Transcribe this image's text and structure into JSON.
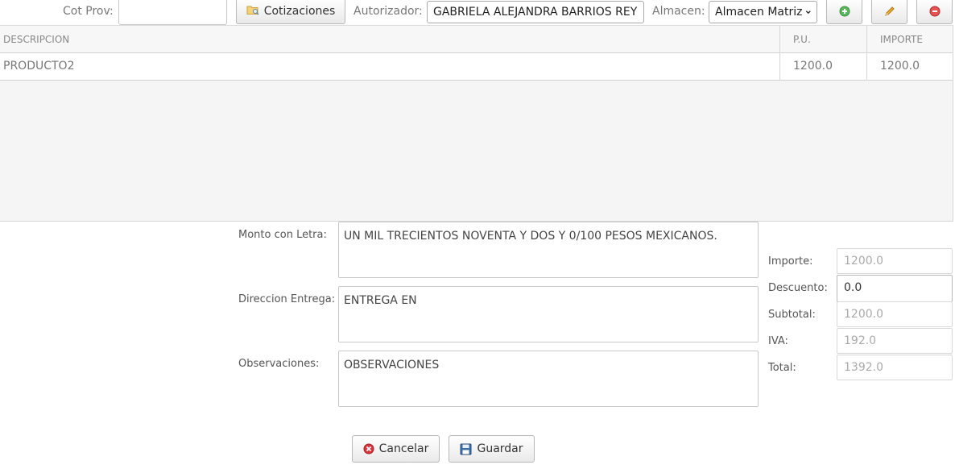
{
  "toolbar": {
    "cot_prov_label": "Cot Prov:",
    "cot_prov_value": "",
    "cotizaciones_label": "Cotizaciones",
    "autorizador_label": "Autorizador:",
    "autorizador_value": "GABRIELA ALEJANDRA BARRIOS REY",
    "almacen_label": "Almacen:",
    "almacen_value": "Almacen Matriz",
    "add_icon": "add-icon",
    "edit_icon": "pencil-icon",
    "remove_icon": "remove-icon"
  },
  "grid": {
    "columns": [
      "DESCRIPCION",
      "P.U.",
      "IMPORTE"
    ],
    "rows": [
      {
        "descripcion": "PRODUCTO2",
        "pu": "1200.0",
        "importe": "1200.0"
      }
    ]
  },
  "form": {
    "monto_label": "Monto con Letra:",
    "monto_value": "UN MIL TRECIENTOS NOVENTA Y DOS Y 0/100 PESOS MEXICANOS.",
    "direccion_label": "Direccion Entrega:",
    "direccion_value": "ENTREGA EN",
    "observaciones_label": "Observaciones:",
    "observaciones_value": "OBSERVACIONES"
  },
  "totals": {
    "importe_label": "Importe:",
    "importe_value": "1200.0",
    "descuento_label": "Descuento:",
    "descuento_value": "0.0",
    "subtotal_label": "Subtotal:",
    "subtotal_value": "1200.0",
    "iva_label": "IVA:",
    "iva_value": "192.0",
    "total_label": "Total:",
    "total_value": "1392.0"
  },
  "actions": {
    "cancel_label": "Cancelar",
    "save_label": "Guardar"
  },
  "colors": {
    "add_green": "#4caf50",
    "remove_red": "#e53935",
    "cancel_red": "#d9363e",
    "save_blue": "#3d6fa8",
    "pencil_orange": "#e8a317"
  }
}
